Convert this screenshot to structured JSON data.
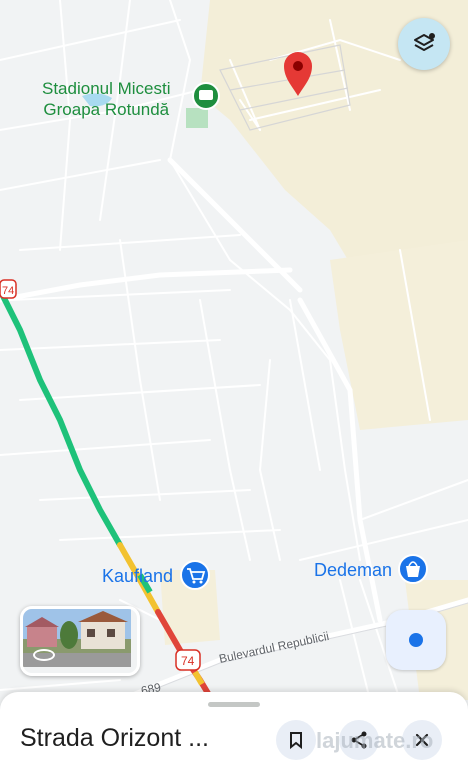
{
  "map": {
    "pois": {
      "stadium": "Stadionul Micesti\nGroapa Rotundă",
      "kaufland": "Kaufland",
      "dedeman": "Dedeman"
    },
    "roads": {
      "bulevard": "Bulevardul Republicii",
      "route_74_top": "74",
      "route_74_bottom": "74",
      "route_689": "689"
    },
    "colors": {
      "traffic_green": "#1ec27a",
      "traffic_yellow": "#f2c230",
      "traffic_red": "#e0453a",
      "pin_red": "#e53935",
      "zone_beige": "#f3eed8"
    }
  },
  "controls": {
    "layers_icon": "layers-icon",
    "my_location_icon": "my-location-icon",
    "street_view_icon": "360-rotate-icon"
  },
  "sheet": {
    "title": "Strada Orizont ...",
    "save_icon": "bookmark-icon",
    "share_icon": "share-icon",
    "close_icon": "close-icon"
  },
  "watermark": {
    "text": "lajumate.ro"
  }
}
